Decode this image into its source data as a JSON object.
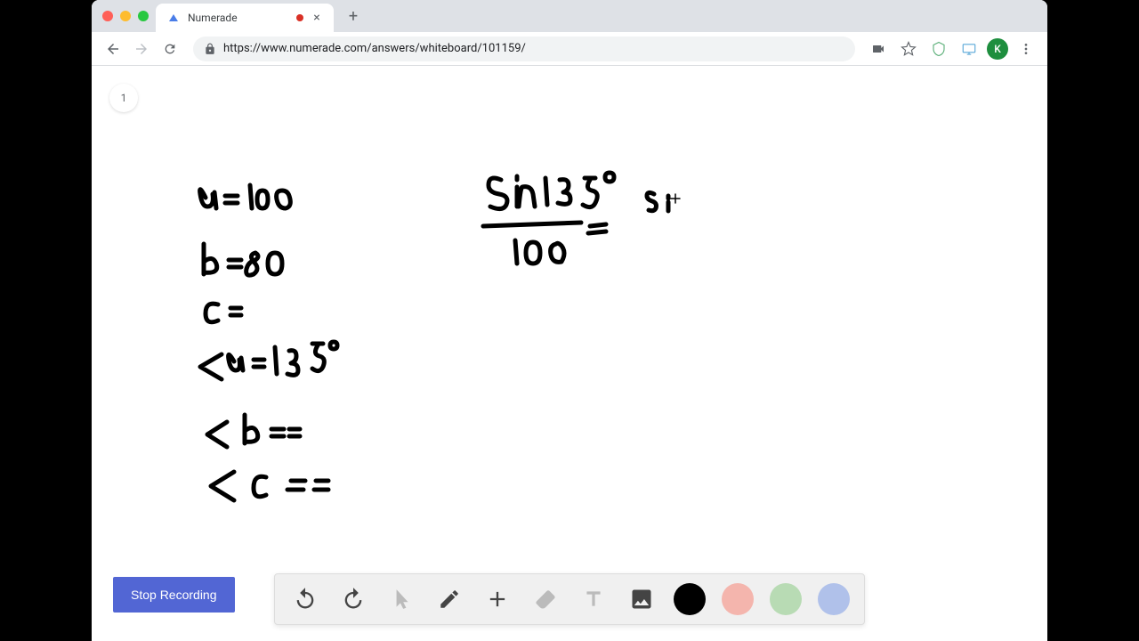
{
  "browser": {
    "tab_title": "Numerade",
    "url_display": "https://www.numerade.com/answers/whiteboard/101159/",
    "avatar_letter": "K"
  },
  "page": {
    "page_number": "1",
    "stop_label": "Stop Recording"
  },
  "handwriting": {
    "line1": "a = 100",
    "line2": "b = 80",
    "line3": "c =",
    "line4": "< a = 135°",
    "line5": "< b =",
    "line6": "< c =",
    "equation_top": "Sin 135°",
    "equation_bottom": "100",
    "equation_right": "si",
    "equals": "="
  },
  "toolbar": {
    "colors": {
      "black": "#000000",
      "red": "#f4b5ad",
      "green": "#b8dbb4",
      "blue": "#b0c1ea"
    }
  }
}
